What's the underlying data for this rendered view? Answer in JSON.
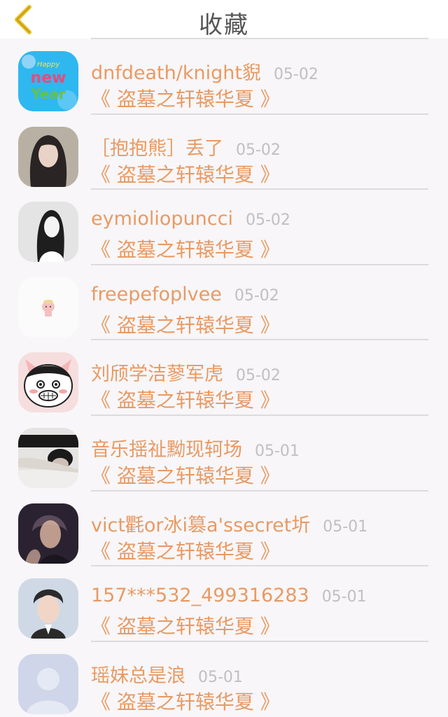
{
  "header": {
    "title": "收藏",
    "back_icon": "chevron-left-icon",
    "accent": "#e8c020"
  },
  "items": [
    {
      "name": "dnfdeath/knight貎",
      "date": "05-02",
      "book": "《 盗墓之轩辕华夏 》",
      "avatar": "avatar-happy-new-year",
      "avatar_text": "Happy New Year",
      "colors": [
        "#2fb7f0",
        "#f7e34a",
        "#e84b7a"
      ]
    },
    {
      "name": "［抱抱熊］丢了",
      "date": "05-02",
      "book": "《 盗墓之轩辕华夏 》",
      "avatar": "avatar-photo-woman",
      "colors": [
        "#b9b0a4",
        "#2a2424",
        "#e8d3c6"
      ]
    },
    {
      "name": "eymioliopuncci",
      "date": "05-02",
      "book": "《 盗墓之轩辕华夏 》",
      "avatar": "avatar-photo-bw",
      "colors": [
        "#e4e4e4",
        "#1e1e1e",
        "#f4f4f4"
      ]
    },
    {
      "name": "freepefoplvee",
      "date": "05-02",
      "book": "《 盗墓之轩辕华夏 》",
      "avatar": "avatar-cartoon-pig",
      "colors": [
        "#fbfbfb",
        "#f4c0c0",
        "#f1d69a"
      ]
    },
    {
      "name": "刘颀学洁蓼军虎",
      "date": "05-02",
      "book": "《 盗墓之轩辕华夏 》",
      "avatar": "avatar-cartoon-cat",
      "colors": [
        "#f6dede",
        "#ffffff",
        "#1e1e1e"
      ]
    },
    {
      "name": "音乐揺祉黝现轲场",
      "date": "05-01",
      "book": "《 盗墓之轩辕华夏 》",
      "avatar": "avatar-photo-man-lying",
      "colors": [
        "#e6e4e2",
        "#1a1a1a",
        "#cdbfb6"
      ]
    },
    {
      "name": "vict氍or冰i篡a'ssecret圻",
      "date": "05-01",
      "book": "《 盗墓之轩辕华夏 》",
      "avatar": "avatar-photo-man-dark",
      "colors": [
        "#2a2230",
        "#d7b19f",
        "#5a4a5a"
      ]
    },
    {
      "name": "157***532_499316283",
      "date": "05-01",
      "book": "《 盗墓之轩辕华夏 》",
      "avatar": "avatar-photo-man-portrait",
      "colors": [
        "#cfd9e6",
        "#2a2a2a",
        "#f1d6c8"
      ]
    },
    {
      "name": "瑶妹总是浪",
      "date": "05-01",
      "book": "《 盗墓之轩辕华夏 》",
      "avatar": "default-avatar-icon",
      "colors": [
        "#cfd6ea",
        "#ffffff",
        "#e5e9f4"
      ]
    }
  ]
}
